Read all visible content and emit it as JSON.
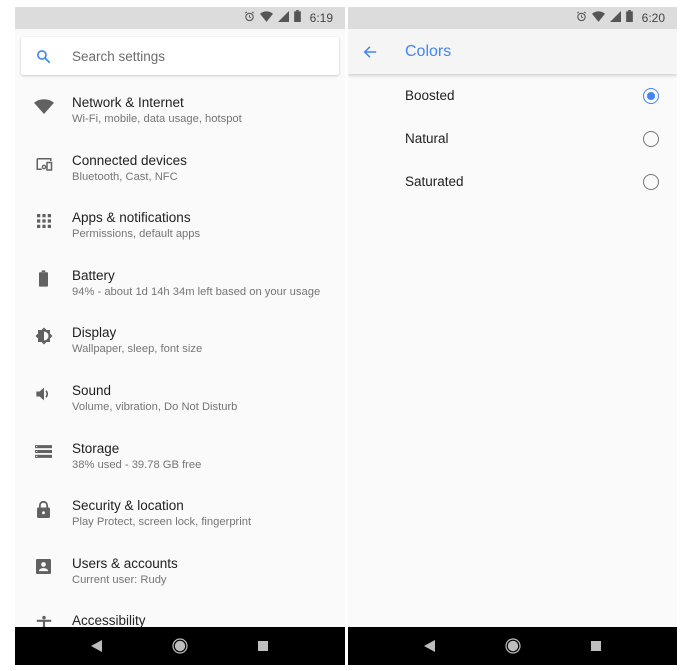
{
  "left_screen": {
    "status_bar": {
      "time": "6:19",
      "icons": [
        "alarm-icon",
        "wifi-icon",
        "cell-signal-icon",
        "battery-icon"
      ]
    },
    "search": {
      "icon": "search-icon",
      "placeholder": "Search settings"
    },
    "items": [
      {
        "icon": "wifi-icon",
        "title": "Network & Internet",
        "subtitle": "Wi-Fi, mobile, data usage, hotspot"
      },
      {
        "icon": "connected-devices-icon",
        "title": "Connected devices",
        "subtitle": "Bluetooth, Cast, NFC"
      },
      {
        "icon": "apps-grid-icon",
        "title": "Apps & notifications",
        "subtitle": "Permissions, default apps"
      },
      {
        "icon": "battery-icon",
        "title": "Battery",
        "subtitle": "94% - about 1d 14h 34m left based on your usage"
      },
      {
        "icon": "brightness-icon",
        "title": "Display",
        "subtitle": "Wallpaper, sleep, font size"
      },
      {
        "icon": "volume-icon",
        "title": "Sound",
        "subtitle": "Volume, vibration, Do Not Disturb"
      },
      {
        "icon": "storage-icon",
        "title": "Storage",
        "subtitle": "38% used - 39.78 GB free"
      },
      {
        "icon": "lock-icon",
        "title": "Security & location",
        "subtitle": "Play Protect, screen lock, fingerprint"
      },
      {
        "icon": "account-box-icon",
        "title": "Users & accounts",
        "subtitle": "Current user: Rudy"
      },
      {
        "icon": "accessibility-icon",
        "title": "Accessibility",
        "subtitle": ""
      }
    ],
    "nav_bar": {
      "back": "back-triangle-icon",
      "home": "home-circle-icon",
      "recents": "recents-square-icon"
    }
  },
  "right_screen": {
    "status_bar": {
      "time": "6:20",
      "icons": [
        "alarm-icon",
        "wifi-icon",
        "cell-signal-icon",
        "battery-icon"
      ]
    },
    "app_bar": {
      "back_icon": "arrow-back-icon",
      "title": "Colors"
    },
    "options": [
      {
        "label": "Boosted",
        "selected": true
      },
      {
        "label": "Natural",
        "selected": false
      },
      {
        "label": "Saturated",
        "selected": false
      }
    ],
    "nav_bar": {
      "back": "back-triangle-icon",
      "home": "home-circle-icon",
      "recents": "recents-square-icon"
    }
  },
  "colors": {
    "accent": "#4285f4",
    "icon_gray": "#616161",
    "status_bar_bg": "#dcdcdc",
    "nav_bar_bg": "#000000",
    "background": "#fafafa"
  }
}
